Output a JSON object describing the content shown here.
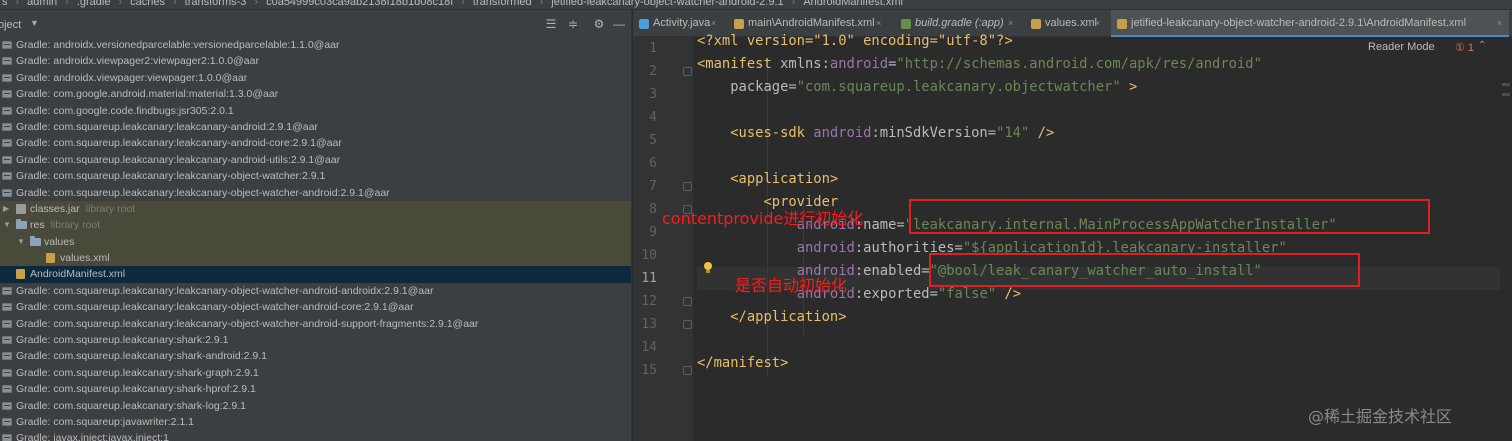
{
  "breadcrumb": [
    "s",
    "admin",
    ".gradle",
    "caches",
    "transforms-3",
    "c0a54999c03ca9ab2138f18b1d08c18f",
    "transformed",
    "jetified-leakcanary-object-watcher-android-2.9.1",
    "AndroidManifest.xml"
  ],
  "project_panel": {
    "title": "oject",
    "tree": [
      {
        "label": "Gradle: androidx.versionedparcelable:versionedparcelable:1.1.0@aar",
        "kind": "library"
      },
      {
        "label": "Gradle: androidx.viewpager2:viewpager2:1.0.0@aar",
        "kind": "library"
      },
      {
        "label": "Gradle: androidx.viewpager:viewpager:1.0.0@aar",
        "kind": "library"
      },
      {
        "label": "Gradle: com.google.android.material:material:1.3.0@aar",
        "kind": "library"
      },
      {
        "label": "Gradle: com.google.code.findbugs:jsr305:2.0.1",
        "kind": "library"
      },
      {
        "label": "Gradle: com.squareup.leakcanary:leakcanary-android:2.9.1@aar",
        "kind": "library"
      },
      {
        "label": "Gradle: com.squareup.leakcanary:leakcanary-android-core:2.9.1@aar",
        "kind": "library"
      },
      {
        "label": "Gradle: com.squareup.leakcanary:leakcanary-android-utils:2.9.1@aar",
        "kind": "library"
      },
      {
        "label": "Gradle: com.squareup.leakcanary:leakcanary-object-watcher:2.9.1",
        "kind": "library"
      },
      {
        "label": "Gradle: com.squareup.leakcanary:leakcanary-object-watcher-android:2.9.1@aar",
        "kind": "library"
      },
      {
        "label": "classes.jar",
        "sub": "library root",
        "kind": "jar"
      },
      {
        "label": "res",
        "sub": "library root",
        "kind": "folder"
      },
      {
        "label": "values",
        "kind": "folder"
      },
      {
        "label": "values.xml",
        "kind": "xml"
      },
      {
        "label": "AndroidManifest.xml",
        "kind": "xml"
      },
      {
        "label": "Gradle: com.squareup.leakcanary:leakcanary-object-watcher-android-androidx:2.9.1@aar",
        "kind": "library"
      },
      {
        "label": "Gradle: com.squareup.leakcanary:leakcanary-object-watcher-android-core:2.9.1@aar",
        "kind": "library"
      },
      {
        "label": "Gradle: com.squareup.leakcanary:leakcanary-object-watcher-android-support-fragments:2.9.1@aar",
        "kind": "library"
      },
      {
        "label": "Gradle: com.squareup.leakcanary:shark:2.9.1",
        "kind": "library"
      },
      {
        "label": "Gradle: com.squareup.leakcanary:shark-android:2.9.1",
        "kind": "library"
      },
      {
        "label": "Gradle: com.squareup.leakcanary:shark-graph:2.9.1",
        "kind": "library"
      },
      {
        "label": "Gradle: com.squareup.leakcanary:shark-hprof:2.9.1",
        "kind": "library"
      },
      {
        "label": "Gradle: com.squareup.leakcanary:shark-log:2.9.1",
        "kind": "library"
      },
      {
        "label": "Gradle: com.squareup:javawriter:2.1.1",
        "kind": "library"
      },
      {
        "label": "Gradle: javax.inject:javax.inject:1",
        "kind": "library"
      }
    ]
  },
  "tabs": [
    {
      "label": "Activity.java",
      "icon_color": "#4a9fd8"
    },
    {
      "label": "main\\AndroidManifest.xml",
      "icon_color": "#c9a04a"
    },
    {
      "label": "build.gradle (:app)",
      "icon_color": "#6a8f4a"
    },
    {
      "label": "values.xml",
      "icon_color": "#c9a04a"
    },
    {
      "label": "jetified-leakcanary-object-watcher-android-2.9.1\\AndroidManifest.xml",
      "icon_color": "#c9a04a"
    }
  ],
  "editor": {
    "reader_mode": "Reader Mode",
    "error_count": "① 1",
    "current_line": 11,
    "line_numbers": [
      "1",
      "2",
      "3",
      "4",
      "5",
      "6",
      "7",
      "8",
      "9",
      "10",
      "11",
      "12",
      "13",
      "14",
      "15"
    ],
    "lines": [
      [
        [
          "pun",
          "<?xml version=\"1.0\" encoding=\"utf-8\"?>"
        ]
      ],
      [
        [
          "pun",
          "<manifest "
        ],
        [
          "at",
          "xmlns:"
        ],
        [
          "ns",
          "android"
        ],
        [
          "at",
          "="
        ],
        [
          "str",
          "\"http://schemas.android.com/apk/res/android\""
        ]
      ],
      [
        [
          "at",
          "    package"
        ],
        [
          "at",
          "="
        ],
        [
          "str",
          "\"com.squareup.leakcanary.objectwatcher\""
        ],
        [
          "pun",
          " >"
        ]
      ],
      [],
      [
        [
          "pun",
          "    <uses-sdk "
        ],
        [
          "ns",
          "android"
        ],
        [
          "at",
          ":minSdkVersion="
        ],
        [
          "str",
          "\"14\""
        ],
        [
          "pun",
          " />"
        ]
      ],
      [],
      [
        [
          "pun",
          "    <application>"
        ]
      ],
      [
        [
          "pun",
          "        <provider"
        ]
      ],
      [
        [
          "at",
          "            "
        ],
        [
          "ns",
          "android"
        ],
        [
          "at",
          ":name="
        ],
        [
          "str",
          "\"leakcanary.internal.MainProcessAppWatcherInstaller\""
        ]
      ],
      [
        [
          "at",
          "            "
        ],
        [
          "ns",
          "android"
        ],
        [
          "at",
          ":authorities="
        ],
        [
          "str",
          "\"${applicationId}.leakcanary-installer\""
        ]
      ],
      [
        [
          "at",
          "            "
        ],
        [
          "ns",
          "android"
        ],
        [
          "at",
          ":enabled="
        ],
        [
          "str",
          "\"@bool/leak_canary_watcher_auto_install\""
        ]
      ],
      [
        [
          "at",
          "            "
        ],
        [
          "ns",
          "android"
        ],
        [
          "at",
          ":exported="
        ],
        [
          "str",
          "\"false\""
        ],
        [
          "pun",
          " />"
        ]
      ],
      [
        [
          "pun",
          "    </application>"
        ]
      ],
      [],
      [
        [
          "pun",
          "</manifest>"
        ]
      ]
    ]
  },
  "annotations": {
    "provider_note": "contentprovide进行初始化",
    "enabled_note": "是否自动初始化"
  },
  "watermark": "@稀土掘金技术社区"
}
